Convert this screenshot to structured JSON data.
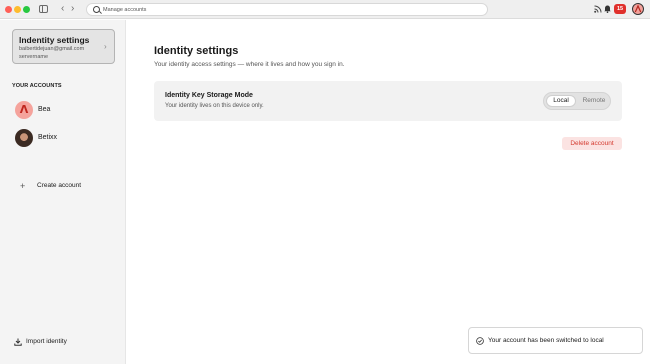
{
  "titlebar": {
    "search_placeholder": "Manage accounts",
    "notification_count": "15",
    "icons": [
      "sidebar-toggle-icon",
      "chevron-left-icon",
      "chevron-right-icon",
      "search-icon",
      "rss-icon",
      "bell-icon"
    ]
  },
  "sidebar": {
    "identity_card": {
      "title": "Indentity settings",
      "email": "baibertidejuan@gmail.com",
      "server": "servername"
    },
    "accounts_heading": "YOUR ACCOUNTS",
    "accounts": [
      {
        "name": "Bea",
        "avatar": "Λ"
      },
      {
        "name": "Betixx"
      }
    ],
    "create_account_label": "Create account",
    "import_identity_label": "Import identity"
  },
  "main": {
    "title": "Identity settings",
    "subtitle": "Your identity access settings — where it lives and how you sign in.",
    "storage_setting": {
      "title": "Identity Key Storage Mode",
      "description": "Your identity lives on this device only.",
      "options": [
        "Local",
        "Remote"
      ],
      "selected": "Local"
    },
    "delete_account_label": "Delete account"
  },
  "toast": {
    "message": "Your account has been switched to local"
  },
  "colors": {
    "accent_red": "#e0302c",
    "delete_text": "#d43a2f",
    "delete_bg": "#fbe3e2",
    "avatar_pink": "#f5a39c"
  }
}
